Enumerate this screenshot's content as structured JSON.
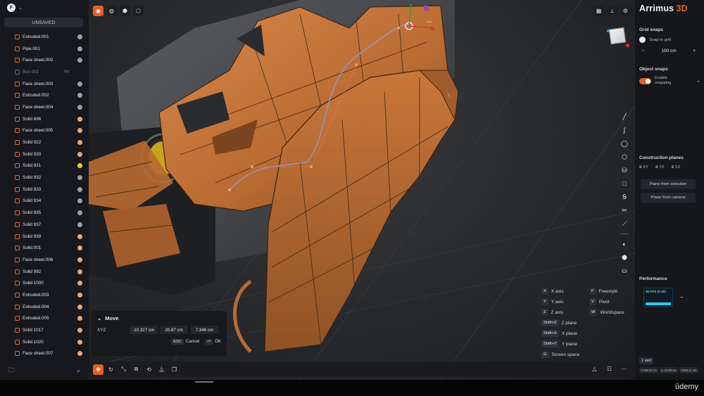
{
  "sidebar": {
    "logo": "F",
    "status": "UNSAVED",
    "layers": [
      {
        "name": "Extruded.001",
        "dot": "#9ba0a8"
      },
      {
        "name": "Pipe.001",
        "dot": "#9ba0a8"
      },
      {
        "name": "Face sheet.002",
        "dot": "#9ba0a8"
      },
      {
        "name": "Box.001",
        "dot": "",
        "tag": "hid",
        "dim": true
      },
      {
        "name": "Face sheet.003",
        "dot": "#9ba0a8"
      },
      {
        "name": "Extruded.002",
        "dot": "#9ba0a8"
      },
      {
        "name": "Face sheet.004",
        "dot": "#9ba0a8"
      },
      {
        "name": "Solid 896",
        "dot": "#e8a87c"
      },
      {
        "name": "Face sheet.005",
        "dot": "#e8a87c"
      },
      {
        "name": "Solid 922",
        "dot": "#e8a87c"
      },
      {
        "name": "Solid 930",
        "dot": "#e8a87c"
      },
      {
        "name": "Solid 931",
        "dot": "#f0d020"
      },
      {
        "name": "Solid 932",
        "dot": "#9ba0a8"
      },
      {
        "name": "Solid 933",
        "dot": "#9ba0a8"
      },
      {
        "name": "Solid 934",
        "dot": "#9ba0a8"
      },
      {
        "name": "Solid 935",
        "dot": "#9ba0a8"
      },
      {
        "name": "Solid 937",
        "dot": "#9ba0a8"
      },
      {
        "name": "Solid 939",
        "dot": "#e8a87c"
      },
      {
        "name": "Solid.001",
        "dot": "#e8a87c"
      },
      {
        "name": "Face sheet.006",
        "dot": "#e8a87c"
      },
      {
        "name": "Solid 992",
        "dot": "#e8a87c"
      },
      {
        "name": "Solid 1000",
        "dot": "#e8a87c"
      },
      {
        "name": "Extruded.003",
        "dot": "#e8a87c"
      },
      {
        "name": "Extruded.004",
        "dot": "#e8a87c"
      },
      {
        "name": "Extruded.005",
        "dot": "#e8a87c"
      },
      {
        "name": "Solid 1017",
        "dot": "#e8a87c"
      },
      {
        "name": "Solid 1020",
        "dot": "#e8a87c"
      },
      {
        "name": "Face sheet.007",
        "dot": "#e8a87c"
      }
    ]
  },
  "move_panel": {
    "title": "Move",
    "row_label": "XYZ",
    "x": "-10.327 cm",
    "y": "20.87 cm",
    "z": "7.346 cm",
    "cancel_key": "ESC",
    "cancel_label": "Cancel",
    "ok_key": "⏎",
    "ok_label": "OK"
  },
  "shortcuts": [
    {
      "key": "X",
      "label": "X axis"
    },
    {
      "key": "Y",
      "label": "Y axis"
    },
    {
      "key": "Z",
      "label": "Z axis"
    },
    {
      "key": "Shift+Z",
      "label": "Z plane"
    },
    {
      "key": "Shift+X",
      "label": "X plane"
    },
    {
      "key": "Shift+Y",
      "label": "Y plane"
    },
    {
      "key": "G",
      "label": "Screen space"
    },
    {
      "key": "F",
      "label": "Freestyle"
    },
    {
      "key": "V",
      "label": "Pivot"
    },
    {
      "key": "W",
      "label": "Worldspace"
    }
  ],
  "right_panel": {
    "brand": "Arrimus",
    "brand_suffix": "3D",
    "grid_snaps_title": "Grid snaps",
    "snap_to_grid": "Snap to grid",
    "grid_value": "100 cm",
    "object_snaps_title": "Object snaps",
    "enable_snapping": "Enable snapping",
    "construction_planes_title": "Construction planes",
    "planes": [
      "XY",
      "YZ",
      "XZ"
    ],
    "plane_from_selection": "Plane from selection",
    "plane_from_camera": "Plane from camera",
    "performance_title": "Performance",
    "fps_label": "30 FPS (0-32)",
    "vert_badge": "1 vert",
    "coords": [
      "x:108.54 cm",
      "y:-10.89 cm",
      "z:823.21 cm"
    ]
  },
  "footer": {
    "watermark": "ûdemy"
  },
  "colors": {
    "accent": "#e0612a",
    "mesh": "#c9773a"
  }
}
